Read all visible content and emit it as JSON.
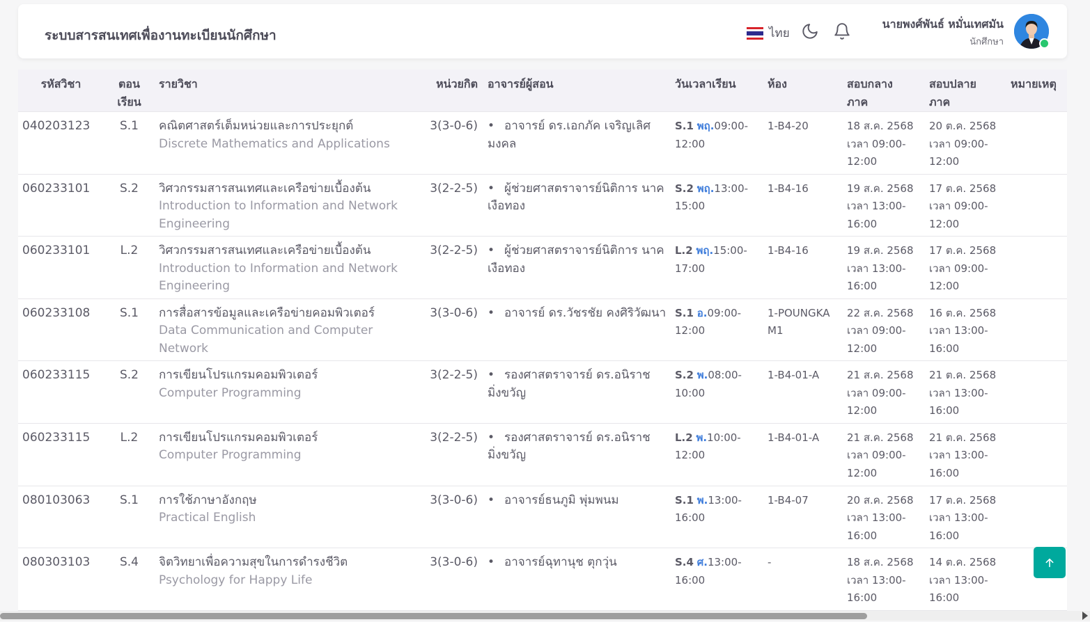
{
  "header": {
    "app_title": "ระบบสารสนเทศเพื่องานทะเบียนนักศึกษา",
    "language_label": "ไทย",
    "user_name": "นายพงศ์พันธ์ หมั่นเทศมัน",
    "user_role": "นักศึกษา",
    "icons": [
      "thai-flag-icon",
      "moon-icon",
      "bell-icon"
    ]
  },
  "table": {
    "headers": {
      "code": "รหัสวิชา",
      "section_line1": "ตอน",
      "section_line2": "เรียน",
      "subject": "รายวิชา",
      "credit": "หน่วยกิต",
      "teacher": "อาจารย์ผู้สอน",
      "schedule": "วันเวลาเรียน",
      "room": "ห้อง",
      "midterm_line1": "สอบกลาง",
      "midterm_line2": "ภาค",
      "final_line1": "สอบปลาย",
      "final_line2": "ภาค",
      "note": "หมายเหตุ"
    },
    "rows": [
      {
        "code": "040203123",
        "section": "S.1",
        "name_th": "คณิตศาสตร์เต็มหน่วยและการประยุกต์",
        "name_en": "Discrete Mathematics and Applications",
        "credit": "3(3-0-6)",
        "teacher": "อาจารย์ ดร.เอกภัค เจริญเลิศมงคล",
        "sched_sec": "S.1",
        "sched_day": "พฤ.",
        "sched_time": "09:00-12:00",
        "room": "1-B4-20",
        "midterm_date": "18 ส.ค. 2568",
        "midterm_time": "เวลา 09:00-12:00",
        "final_date": "20 ต.ค. 2568",
        "final_time": "เวลา 09:00-12:00",
        "note": ""
      },
      {
        "code": "060233101",
        "section": "S.2",
        "name_th": "วิศวกรรมสารสนเทศและเครือข่ายเบื้องต้น",
        "name_en": "Introduction to Information and Network Engineering",
        "credit": "3(2-2-5)",
        "teacher": "ผู้ช่วยศาสตราจารย์นิติการ นาคเงือทอง",
        "sched_sec": "S.2",
        "sched_day": "พฤ.",
        "sched_time": "13:00-15:00",
        "room": "1-B4-16",
        "midterm_date": "19 ส.ค. 2568",
        "midterm_time": "เวลา 13:00-16:00",
        "final_date": "17 ต.ค. 2568",
        "final_time": "เวลา 09:00-12:00",
        "note": ""
      },
      {
        "code": "060233101",
        "section": "L.2",
        "name_th": "วิศวกรรมสารสนเทศและเครือข่ายเบื้องต้น",
        "name_en": "Introduction to Information and Network Engineering",
        "credit": "3(2-2-5)",
        "teacher": "ผู้ช่วยศาสตราจารย์นิติการ นาคเงือทอง",
        "sched_sec": "L.2",
        "sched_day": "พฤ.",
        "sched_time": "15:00-17:00",
        "room": "1-B4-16",
        "midterm_date": "19 ส.ค. 2568",
        "midterm_time": "เวลา 13:00-16:00",
        "final_date": "17 ต.ค. 2568",
        "final_time": "เวลา 09:00-12:00",
        "note": ""
      },
      {
        "code": "060233108",
        "section": "S.1",
        "name_th": "การสื่อสารข้อมูลและเครือข่ายคอมพิวเตอร์",
        "name_en": "Data Communication and Computer Network",
        "credit": "3(3-0-6)",
        "teacher": "อาจารย์ ดร.วัชรชัย คงศิริวัฒนา",
        "sched_sec": "S.1",
        "sched_day": "อ.",
        "sched_time": "09:00-12:00",
        "room": "1-POUNGKAM1",
        "midterm_date": "22 ส.ค. 2568",
        "midterm_time": "เวลา 09:00-12:00",
        "final_date": "16 ต.ค. 2568",
        "final_time": "เวลา 13:00-16:00",
        "note": ""
      },
      {
        "code": "060233115",
        "section": "S.2",
        "name_th": "การเขียนโปรแกรมคอมพิวเตอร์",
        "name_en": "Computer Programming",
        "credit": "3(2-2-5)",
        "teacher": "รองศาสตราจารย์ ดร.อนิราช มิ่งขวัญ",
        "sched_sec": "S.2",
        "sched_day": "พ.",
        "sched_time": "08:00-10:00",
        "room": "1-B4-01-A",
        "midterm_date": "21 ส.ค. 2568",
        "midterm_time": "เวลา 09:00-12:00",
        "final_date": "21 ต.ค. 2568",
        "final_time": "เวลา 13:00-16:00",
        "note": ""
      },
      {
        "code": "060233115",
        "section": "L.2",
        "name_th": "การเขียนโปรแกรมคอมพิวเตอร์",
        "name_en": "Computer Programming",
        "credit": "3(2-2-5)",
        "teacher": "รองศาสตราจารย์ ดร.อนิราช มิ่งขวัญ",
        "sched_sec": "L.2",
        "sched_day": "พ.",
        "sched_time": "10:00-12:00",
        "room": "1-B4-01-A",
        "midterm_date": "21 ส.ค. 2568",
        "midterm_time": "เวลา 09:00-12:00",
        "final_date": "21 ต.ค. 2568",
        "final_time": "เวลา 13:00-16:00",
        "note": ""
      },
      {
        "code": "080103063",
        "section": "S.1",
        "name_th": "การใช้ภาษาอังกฤษ",
        "name_en": "Practical English",
        "credit": "3(3-0-6)",
        "teacher": "อาจารย์ธนภูมิ พุ่มพนม",
        "sched_sec": "S.1",
        "sched_day": "พ.",
        "sched_time": "13:00-16:00",
        "room": "1-B4-07",
        "midterm_date": "20 ส.ค. 2568",
        "midterm_time": "เวลา 13:00-16:00",
        "final_date": "17 ต.ค. 2568",
        "final_time": "เวลา 13:00-16:00",
        "note": ""
      },
      {
        "code": "080303103",
        "section": "S.4",
        "name_th": "จิตวิทยาเพื่อความสุขในการดำรงชีวิต",
        "name_en": "Psychology for Happy Life",
        "credit": "3(3-0-6)",
        "teacher": "อาจารย์ฉุทานุช ตุกวุ่น",
        "sched_sec": "S.4",
        "sched_day": "ศ.",
        "sched_time": "13:00-16:00",
        "room": "-",
        "midterm_date": "18 ส.ค. 2568",
        "midterm_time": "เวลา 13:00-16:00",
        "final_date": "14 ต.ค. 2568",
        "final_time": "เวลา 13:00-16:00",
        "note": ""
      }
    ]
  },
  "theme": {
    "accent_blue": "#3f7ddb",
    "scroll_top_button": "#00a99d",
    "online_status": "#28c76f"
  }
}
